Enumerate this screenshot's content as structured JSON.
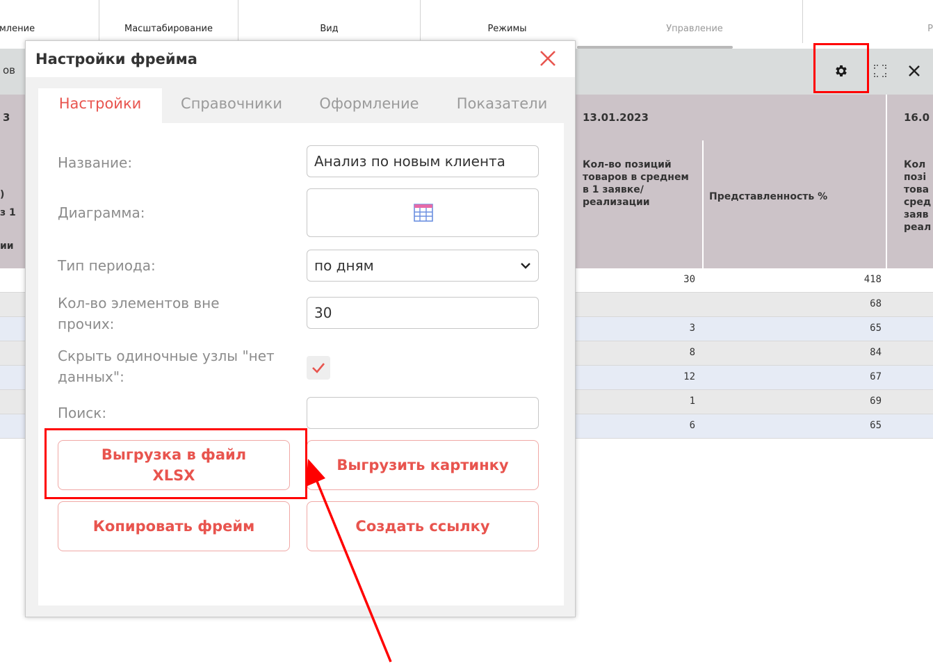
{
  "ribbon": {
    "groups": [
      "мление",
      "Масштабирование",
      "Вид",
      "Режимы",
      "Управление",
      "Р"
    ]
  },
  "frame": {
    "title_cut": "ов",
    "tools": [
      "gear-icon",
      "expand-icon",
      "close-icon"
    ]
  },
  "table": {
    "left_head_top": "3",
    "left_head_mid": [
      ")",
      "з 1",
      "ии"
    ],
    "date_1": "13.01.2023",
    "date_2": "16.0",
    "col_positions": "Кол-во позиций товаров в среднем в 1 заявке/ реализации",
    "col_share": "Представленность %",
    "col_cut": "Кол позі това сред заяв реал",
    "rows": [
      {
        "a": "30",
        "b": "418"
      },
      {
        "a": "",
        "b": "68"
      },
      {
        "a": "3",
        "b": "65"
      },
      {
        "a": "8",
        "b": "84"
      },
      {
        "a": "12",
        "b": "67"
      },
      {
        "a": "1",
        "b": "69"
      },
      {
        "a": "6",
        "b": "65"
      }
    ]
  },
  "dialog": {
    "title": "Настройки фрейма",
    "tabs": [
      "Настройки",
      "Справочники",
      "Оформление",
      "Показатели"
    ],
    "labels": {
      "name": "Название:",
      "chart": "Диаграмма:",
      "period": "Тип периода:",
      "elements": "Кол-во элементов вне прочих:",
      "hide": "Скрыть одиночные узлы \"нет данных\":",
      "search": "Поиск:"
    },
    "values": {
      "name": "Анализ по новым клиента",
      "period": "по дням",
      "elements": "30",
      "search": ""
    },
    "hide_checked": true,
    "buttons": {
      "export_xlsx": "Выгрузка в файл XLSX",
      "export_image": "Выгрузить картинку",
      "copy_frame": "Копировать фрейм",
      "create_link": "Создать ссылку"
    }
  },
  "colors": {
    "accent": "#e8544e",
    "highlight": "#ff0000",
    "header_bg": "#ccc3c8"
  }
}
